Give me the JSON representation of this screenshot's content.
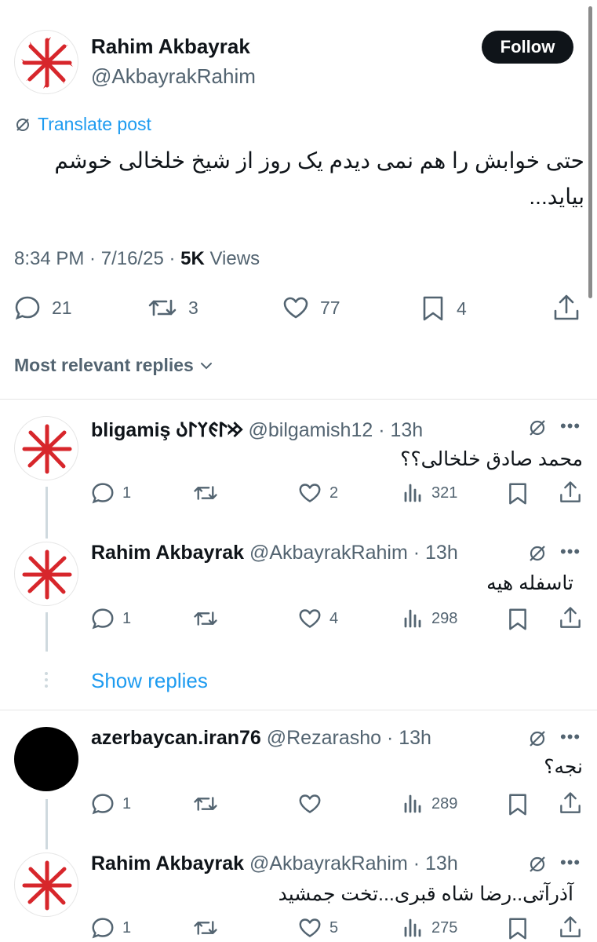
{
  "post": {
    "author_name": "Rahim Akbayrak",
    "author_handle": "@AkbayrakRahim",
    "follow_label": "Follow",
    "translate_label": "Translate post",
    "text": "حتی خوابش را هم نمی دیدم یک روز از  شیخ خلخالی خوشم بیاید...",
    "time": "8:34 PM",
    "date": "7/16/25",
    "views_count": "5K",
    "views_label": "Views",
    "replies": "21",
    "reposts": "3",
    "likes": "77",
    "bookmarks": "4"
  },
  "replies_filter": "Most relevant replies",
  "show_replies_label": "Show replies",
  "replies": [
    {
      "name": "bligamiş 𐰢𐰃𐰏𐰠𐰃𐰉",
      "handle": "@bilgamish12",
      "time": "13h",
      "text": "محمد صادق خلخالی؟؟",
      "replies": "1",
      "reposts": "",
      "likes": "2",
      "views": "321"
    },
    {
      "name": "Rahim Akbayrak",
      "handle": "@AkbayrakRahim",
      "time": "13h",
      "text": "تاسفله هیه",
      "replies": "1",
      "reposts": "",
      "likes": "4",
      "views": "298"
    },
    {
      "name": "azerbaycan.iran76",
      "handle": "@Rezarasho",
      "time": "13h",
      "text": "نجه؟",
      "replies": "1",
      "reposts": "",
      "likes": "",
      "views": "289"
    },
    {
      "name": "Rahim Akbayrak",
      "handle": "@AkbayrakRahim",
      "time": "13h",
      "text": "آذرآتی..رضا شاه قبری...تخت جمشید",
      "replies": "1",
      "reposts": "",
      "likes": "5",
      "views": "275"
    }
  ],
  "separator": " · ",
  "colors": {
    "accent": "#1d9bf0",
    "text": "#0f1419",
    "muted": "#536471",
    "logo_red": "#d7262b"
  },
  "icons": [
    "reply-icon",
    "repost-icon",
    "like-icon",
    "bookmark-icon",
    "share-icon",
    "views-icon",
    "grok-icon",
    "more-icon",
    "chevron-down-icon",
    "translate-icon"
  ]
}
